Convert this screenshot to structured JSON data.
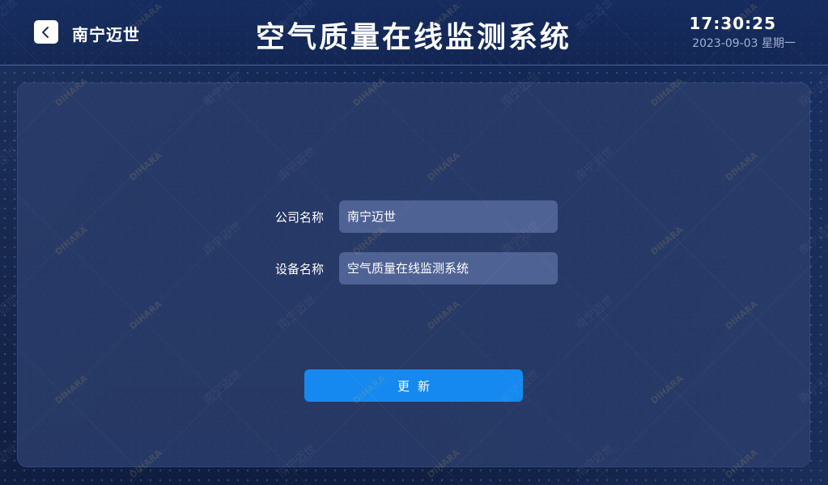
{
  "header": {
    "brand": "南宁迈世",
    "title": "空气质量在线监测系统",
    "time": "17:30:25",
    "date": "2023-09-03  星期一"
  },
  "form": {
    "company_label": "公司名称",
    "company_value": "南宁迈世",
    "device_label": "设备名称",
    "device_value": "空气质量在线监测系统",
    "update_label": "更新"
  },
  "icons": {
    "back": "chevron-left-icon"
  },
  "watermark": {
    "text_cn": "南宁迈世",
    "text_en": "DIHARA"
  },
  "colors": {
    "accent": "#1589ef",
    "panel": "#2a3c6a",
    "field": "#4f6294",
    "background": "#14254d"
  }
}
